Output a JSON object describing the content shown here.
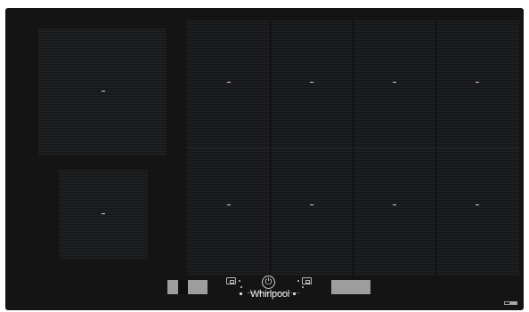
{
  "appliance": {
    "brand": "Whirlpool",
    "type": "induction-hob",
    "colors": {
      "body": "#141415",
      "zone": "#18191b",
      "display": "#9d9d9d",
      "display_dark": "#0d0d0d",
      "accent": "#d6d6d6"
    }
  },
  "cooking_zones": {
    "left_large": {
      "name": "zone-left-large"
    },
    "left_small": {
      "name": "zone-left-small"
    },
    "flex_columns": 4,
    "flex_rows": 2
  },
  "control_panel": {
    "left_display": {
      "segments": 3
    },
    "right_display": {
      "segments": 1
    },
    "icons": [
      "timer-icon",
      "power-icon",
      "lock-icon"
    ]
  }
}
